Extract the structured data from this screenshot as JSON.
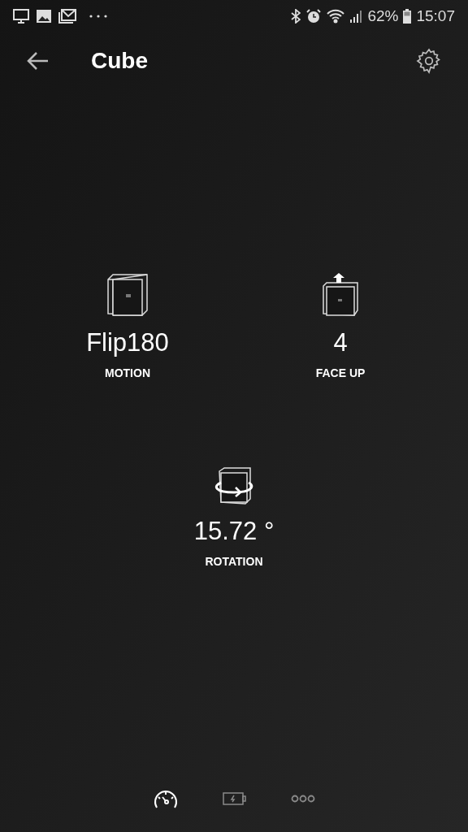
{
  "status_bar": {
    "battery": "62%",
    "time": "15:07"
  },
  "header": {
    "title": "Cube"
  },
  "metrics": [
    {
      "kind": "motion",
      "value": "Flip180",
      "label": "MOTION"
    },
    {
      "kind": "face",
      "value": "4",
      "label": "FACE UP"
    },
    {
      "kind": "rotation",
      "value": "15.72 °",
      "label": "ROTATION"
    }
  ],
  "bottom_tabs": [
    {
      "kind": "gauge",
      "selected": true
    },
    {
      "kind": "battery",
      "selected": false
    },
    {
      "kind": "more",
      "selected": false
    }
  ]
}
